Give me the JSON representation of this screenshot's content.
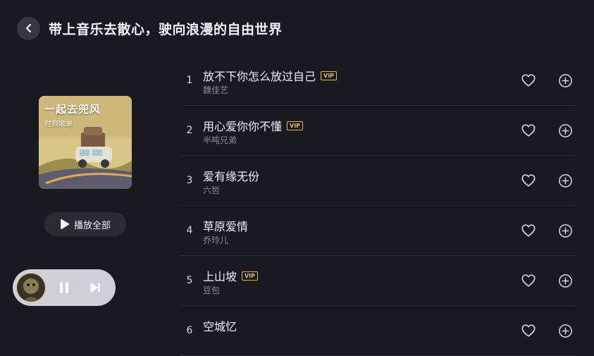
{
  "header": {
    "title": "带上音乐去散心，驶向浪漫的自由世界",
    "back_icon": "chevron-left-icon"
  },
  "playlist": {
    "cover_title": "一起去兜风",
    "cover_subtitle": "时刻歌单",
    "play_all_label": "播放全部"
  },
  "mini_player": {
    "pause_icon": "pause-icon",
    "next_icon": "skip-next-icon"
  },
  "songs": [
    {
      "number": "1",
      "title": "放不下你怎么放过自己",
      "artist": "魏佳艺",
      "vip": "VIP"
    },
    {
      "number": "2",
      "title": "用心爱你你不懂",
      "artist": "半吨兄弟",
      "vip": "VIP"
    },
    {
      "number": "3",
      "title": "爱有缘无份",
      "artist": "六哲",
      "vip": ""
    },
    {
      "number": "4",
      "title": "草原爱情",
      "artist": "乔玲儿",
      "vip": ""
    },
    {
      "number": "5",
      "title": "上山坡",
      "artist": "豆包",
      "vip": "VIP"
    },
    {
      "number": "6",
      "title": "空城忆",
      "artist": "",
      "vip": ""
    }
  ],
  "colors": {
    "background": "#1a191e",
    "vip": "#e2b557",
    "accent_text": "#f0f0f2",
    "secondary_text": "#8e8d94"
  }
}
